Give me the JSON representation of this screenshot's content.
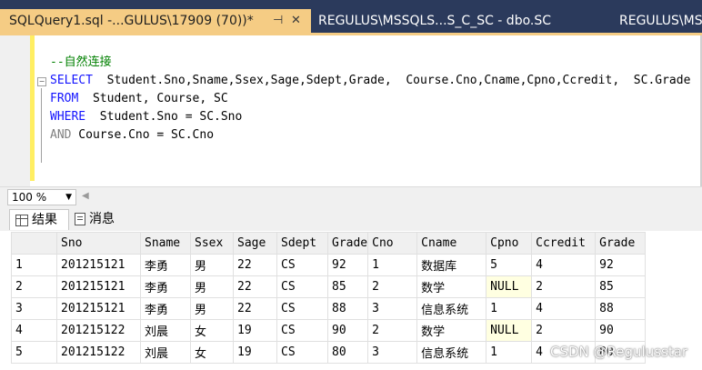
{
  "tabs": {
    "active": {
      "title": "SQLQuery1.sql -...GULUS\\17909 (70))*",
      "pin_icon": "pin-icon",
      "close_icon": "close-icon",
      "pin": "⊣",
      "close": "✕"
    },
    "inactive": [
      {
        "title": "REGULUS\\MSSQLS...S_C_SC - dbo.SC"
      },
      {
        "title": "REGULUS\\MS"
      }
    ]
  },
  "editor": {
    "comment": "--自然连接",
    "line_select_kw": "SELECT",
    "line_select_rest": "  Student.Sno,Sname,Ssex,Sage,Sdept,Grade,  Course.Cno,Cname,Cpno,Ccredit,  SC.Grade",
    "line_from_kw": "FROM",
    "line_from_rest": "  Student, Course, SC",
    "line_where_kw": "WHERE",
    "line_where_rest": "  Student.Sno = SC.Sno",
    "line_and_kw": "AND",
    "line_and_rest": " Course.Cno = SC.Cno"
  },
  "zoom": {
    "value": "100 %"
  },
  "results_tabs": [
    {
      "label": "结果",
      "icon": "grid-icon"
    },
    {
      "label": "消息",
      "icon": "messages-icon"
    }
  ],
  "table": {
    "columns": [
      "Sno",
      "Sname",
      "Ssex",
      "Sage",
      "Sdept",
      "Grade",
      "Cno",
      "Cname",
      "Cpno",
      "Ccredit",
      "Grade"
    ],
    "rows": [
      {
        "num": "1",
        "cells": [
          "201215121",
          "李勇",
          "男",
          "22",
          "CS",
          "92",
          "1",
          "数据库",
          "5",
          "4",
          "92"
        ]
      },
      {
        "num": "2",
        "cells": [
          "201215121",
          "李勇",
          "男",
          "22",
          "CS",
          "85",
          "2",
          "数学",
          "NULL",
          "2",
          "85"
        ]
      },
      {
        "num": "3",
        "cells": [
          "201215121",
          "李勇",
          "男",
          "22",
          "CS",
          "88",
          "3",
          "信息系统",
          "1",
          "4",
          "88"
        ]
      },
      {
        "num": "4",
        "cells": [
          "201215122",
          "刘晨",
          "女",
          "19",
          "CS",
          "90",
          "2",
          "数学",
          "NULL",
          "2",
          "90"
        ]
      },
      {
        "num": "5",
        "cells": [
          "201215122",
          "刘晨",
          "女",
          "19",
          "CS",
          "80",
          "3",
          "信息系统",
          "1",
          "4",
          "80"
        ]
      }
    ]
  },
  "watermark": "CSDN @Regulusstar",
  "colors": {
    "tab_active": "#f5cc84",
    "tab_strip": "#2b3a5c",
    "keyword": "#1414ff",
    "comment": "#008000",
    "null_bg": "#ffffe1"
  }
}
